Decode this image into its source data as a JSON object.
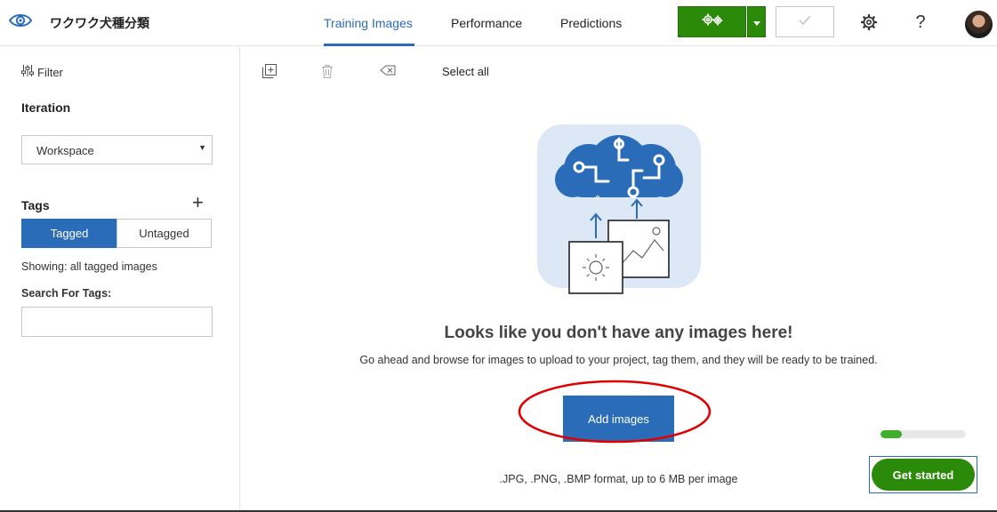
{
  "app": {
    "project_title": "ワクワク犬種分類",
    "logo_icon": "eye-icon"
  },
  "header": {
    "tabs": [
      {
        "label": "Training Images",
        "active": true
      },
      {
        "label": "Performance",
        "active": false
      },
      {
        "label": "Predictions",
        "active": false
      }
    ],
    "train_button_icon": "gears-icon",
    "train_dropdown_icon": "caret-down-icon",
    "quick_test_icon": "check-icon",
    "settings_icon": "gear-icon",
    "help_label": "?",
    "accent_color": "#2b6cb8",
    "train_color": "#2c8a0b"
  },
  "sidebar": {
    "filter_label": "Filter",
    "iteration_heading": "Iteration",
    "iteration_selected": "Workspace",
    "tags_heading": "Tags",
    "add_tag_label": "+",
    "segments": [
      {
        "label": "Tagged",
        "selected": true
      },
      {
        "label": "Untagged",
        "selected": false
      }
    ],
    "showing_text": "Showing: all tagged images",
    "search_label": "Search For Tags:",
    "search_value": ""
  },
  "toolbar": {
    "add_icon": "add-images-icon",
    "delete_icon": "trash-icon",
    "untag_icon": "eraser-icon",
    "select_all_label": "Select all"
  },
  "empty_state": {
    "title": "Looks like you don't have any images here!",
    "subtitle": "Go ahead and browse for images to upload to your project, tag them, and they will be ready to be trained.",
    "add_button_label": "Add images",
    "formats_text": ".JPG, .PNG, .BMP format, up to 6 MB per image",
    "highlight_color": "#e00000"
  },
  "onboarding": {
    "progress_fraction": 0.25,
    "get_started_label": "Get started"
  }
}
